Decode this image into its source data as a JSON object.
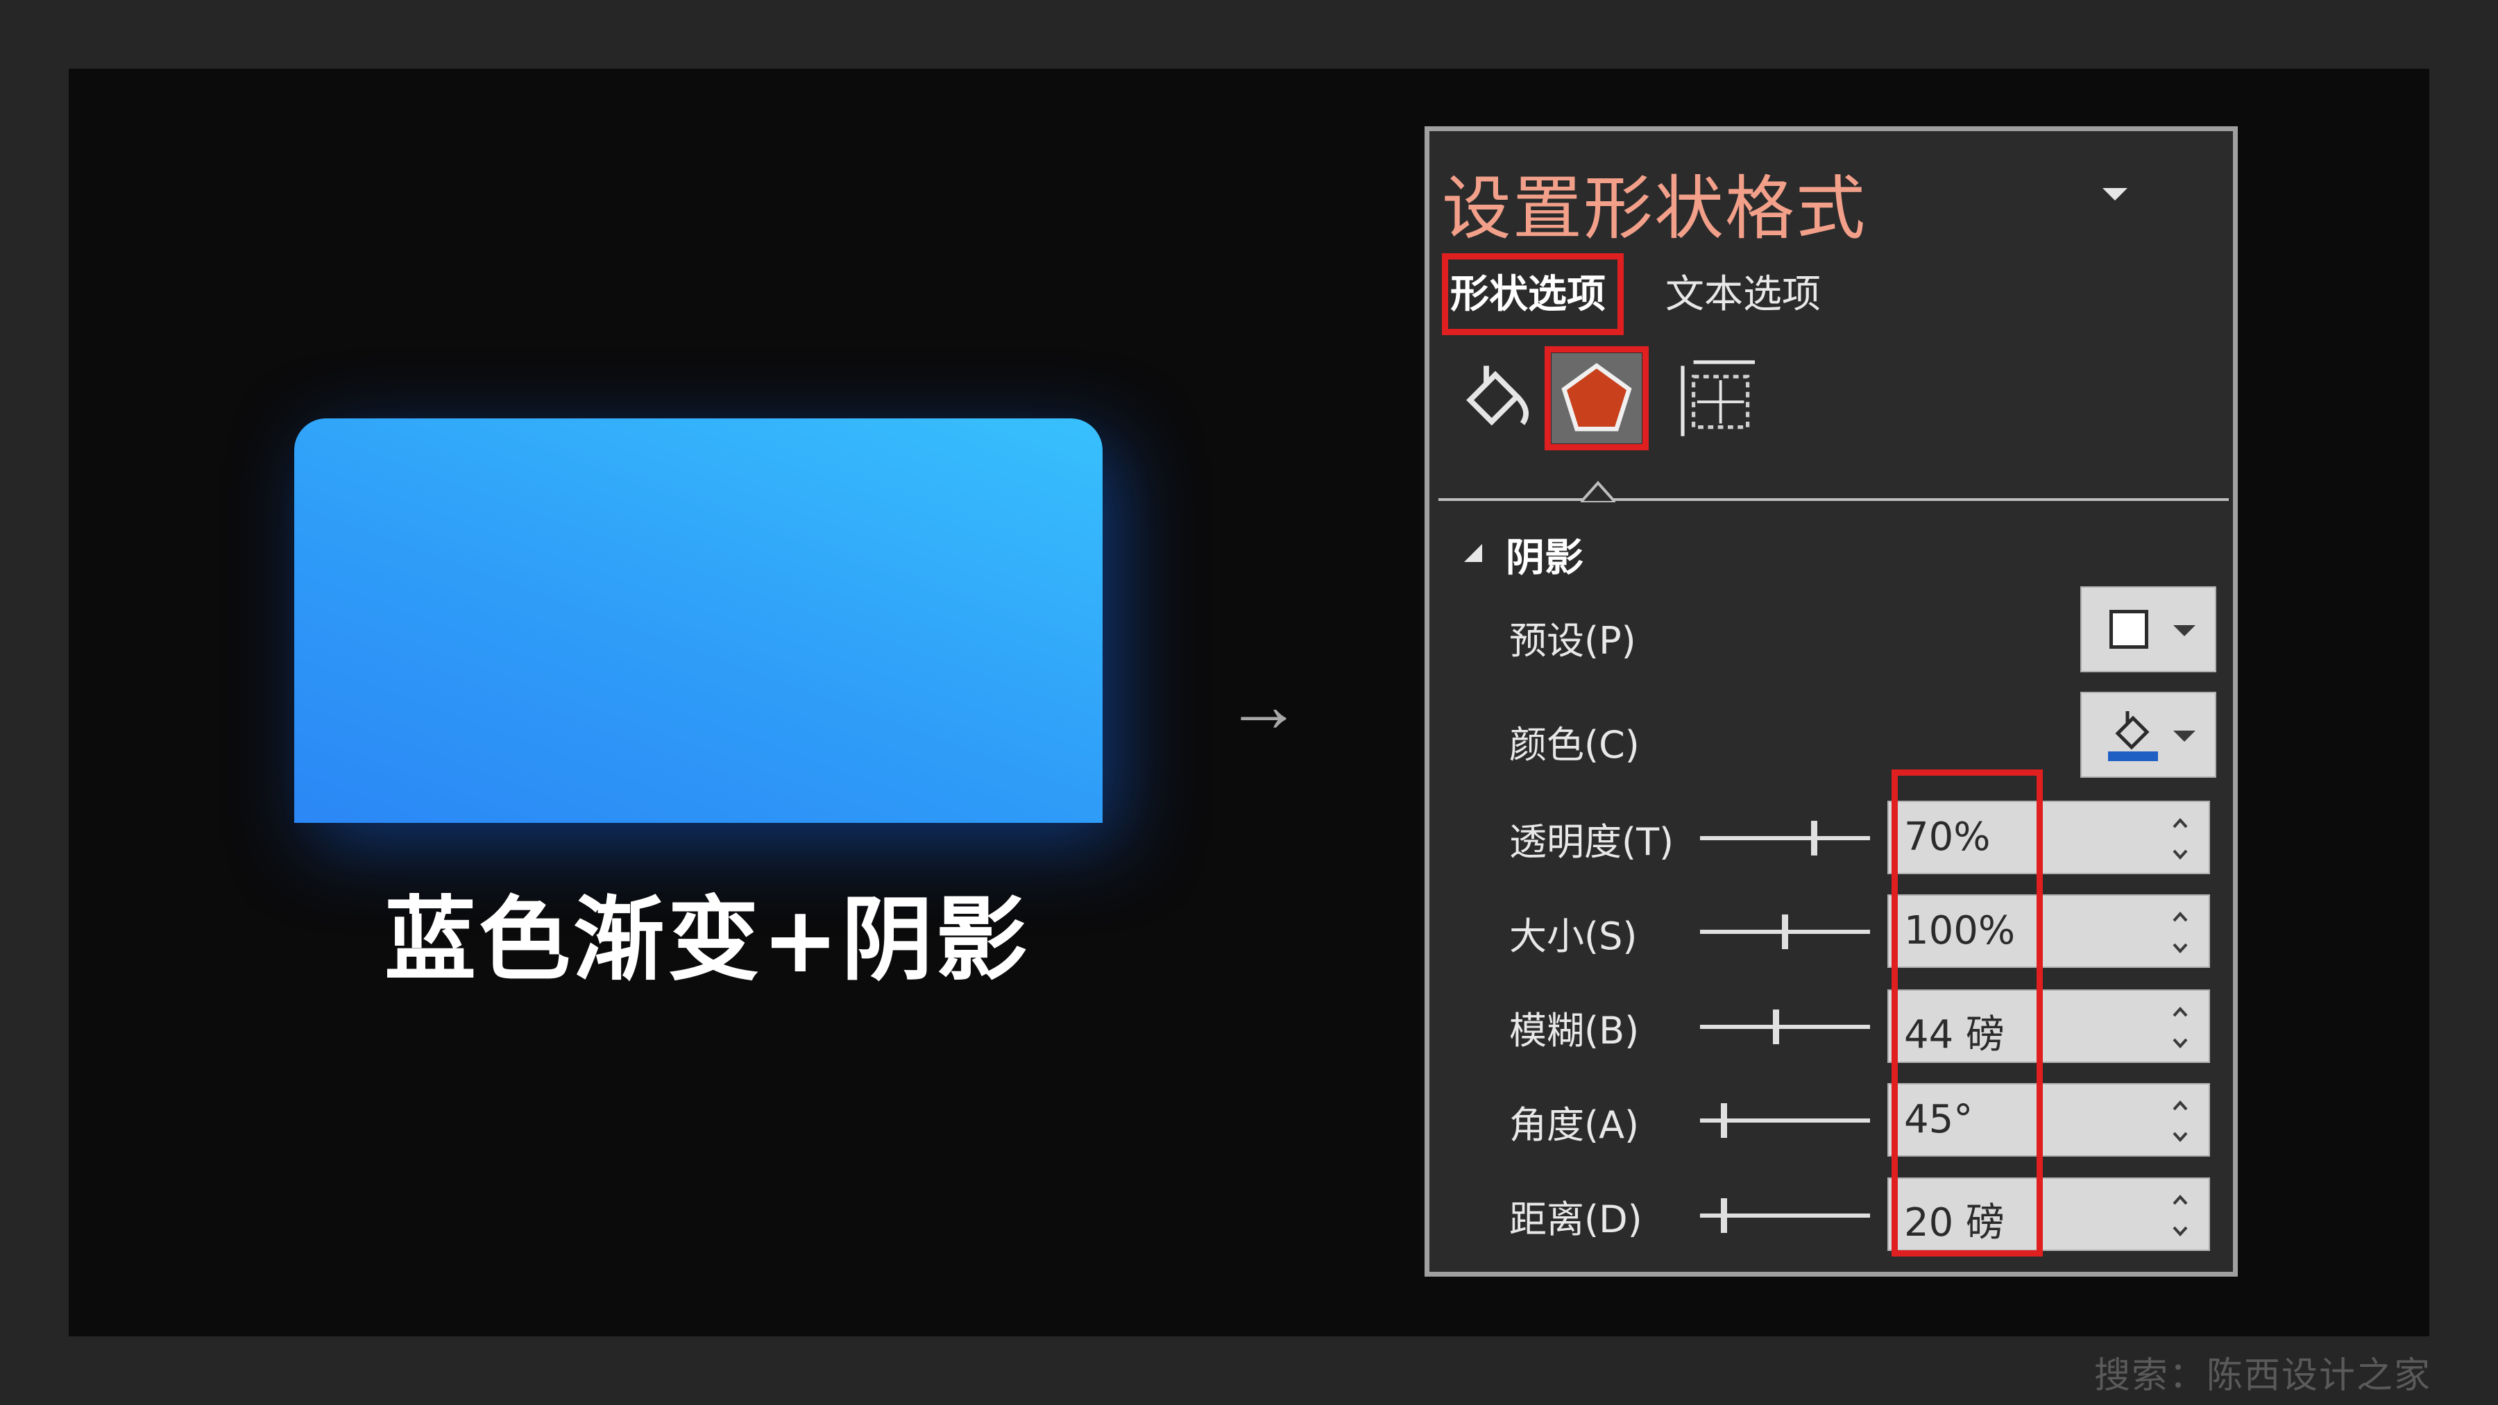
{
  "demo": {
    "caption": "蓝色渐变+阴影",
    "arrow": "→",
    "gradient_colors": [
      "#2b87f5",
      "#38c0fd"
    ],
    "shadow_color": "#1a5fc8"
  },
  "panel": {
    "title": "设置形状格式",
    "tabs": [
      {
        "label": "形状选项",
        "selected": true
      },
      {
        "label": "文本选项",
        "selected": false
      }
    ],
    "icons": [
      "fill-line-icon",
      "effects-pentagon-icon",
      "size-properties-icon"
    ],
    "selected_icon": "effects-pentagon-icon",
    "section": {
      "title": "阴影",
      "expanded": true,
      "preset": {
        "label": "预设(P)"
      },
      "color": {
        "label": "颜色(C)",
        "swatch": "#1f5fc4"
      },
      "settings": [
        {
          "label": "透明度(T)",
          "value": "70%",
          "slider_fraction": 0.7
        },
        {
          "label": "大小(S)",
          "value": "100%",
          "slider_fraction": 0.5
        },
        {
          "label": "模糊(B)",
          "value": "44 磅",
          "slider_fraction": 0.44
        },
        {
          "label": "角度(A)",
          "value": "45°",
          "slider_fraction": 0.125
        },
        {
          "label": "距离(D)",
          "value": "20 磅",
          "slider_fraction": 0.1
        }
      ]
    },
    "accent": "#e02020",
    "title_color": "#f3a08a"
  },
  "watermark": "搜索：陈西设计之家"
}
